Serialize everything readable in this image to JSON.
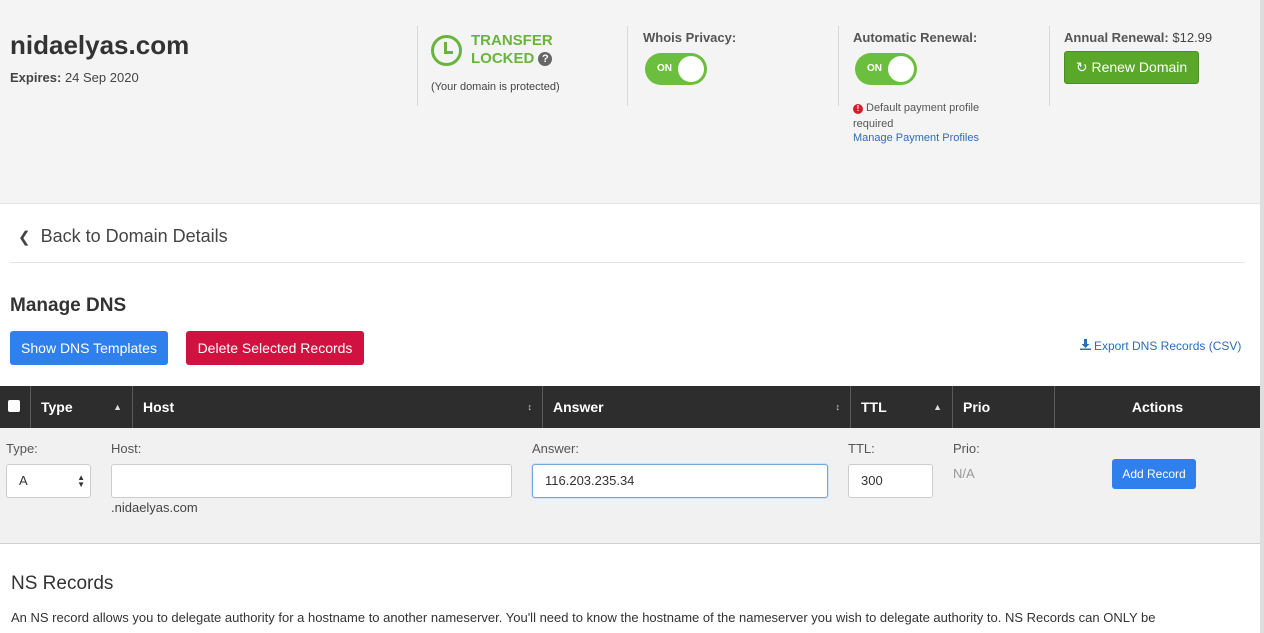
{
  "header": {
    "domain": "nidaelyas.com",
    "expires_label": "Expires:",
    "expires_value": "24 Sep 2020",
    "transfer_line1": "TRANSFER",
    "transfer_line2": "LOCKED",
    "help_glyph": "?",
    "protected_text": "(Your domain is protected)",
    "whois_label": "Whois Privacy:",
    "whois_toggle": "ON",
    "auto_label": "Automatic Renewal:",
    "auto_toggle": "ON",
    "error_text": "Default payment profile required",
    "manage_profiles": "Manage Payment Profiles",
    "annual_label": "Annual Renewal:",
    "annual_price": "$12.99",
    "renew_button": "Renew Domain",
    "accent_green": "#6ab43e"
  },
  "nav": {
    "back_label": "Back to Domain Details"
  },
  "dns": {
    "title": "Manage DNS",
    "show_templates": "Show DNS Templates",
    "delete_selected": "Delete Selected Records",
    "export": "Export DNS Records (CSV)",
    "columns": [
      "Type",
      "Host",
      "Answer",
      "TTL",
      "Prio",
      "Actions"
    ],
    "form": {
      "type_label": "Type:",
      "type_value": "A",
      "host_label": "Host:",
      "host_value": "",
      "host_suffix": ".nidaelyas.com",
      "answer_label": "Answer:",
      "answer_value": "116.203.235.34",
      "ttl_label": "TTL:",
      "ttl_value": "300",
      "prio_label": "Prio:",
      "prio_value": "N/A",
      "add_button": "Add Record"
    }
  },
  "ns": {
    "title": "NS Records",
    "text": "An NS record allows you to delegate authority for a hostname to another nameserver. You'll need to know the hostname of the nameserver you wish to delegate authority to. NS Records can ONLY be"
  }
}
